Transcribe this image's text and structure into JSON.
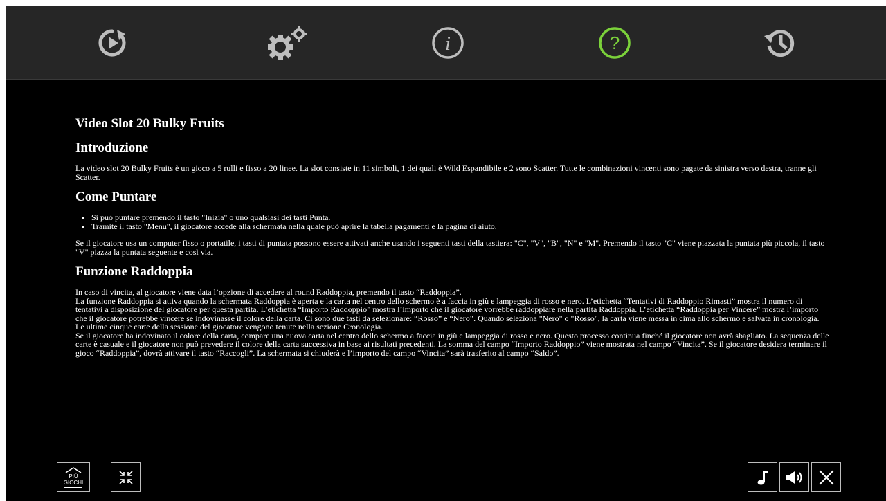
{
  "toolbar": {
    "items": [
      {
        "name": "autoplay-icon"
      },
      {
        "name": "settings-icon"
      },
      {
        "name": "info-icon"
      },
      {
        "name": "help-icon",
        "active": true
      },
      {
        "name": "history-icon"
      }
    ],
    "active_color": "#7bd13a",
    "icon_color": "#bdbdbd"
  },
  "content": {
    "title": "Video Slot 20 Bulky Fruits",
    "intro": {
      "heading": "Introduzione",
      "text": "La video slot 20 Bulky Fruits è un gioco a 5 rulli e fisso a 20 linee. La slot consiste in 11 simboli, 1 dei quali è Wild Espandibile e 2 sono Scatter. Tutte le combinazioni vincenti sono pagate da sinistra verso destra, tranne gli Scatter."
    },
    "betting": {
      "heading": "Come Puntare",
      "bullets": [
        "Si può puntare premendo il tasto \"Inizia\" o uno qualsiasi dei tasti Punta.",
        "Tramite il tasto \"Menu\", il giocatore accede alla schermata nella quale può aprire la tabella pagamenti e la pagina di aiuto."
      ],
      "text": "Se il giocatore usa un computer fisso o portatile, i tasti di puntata possono essere attivati anche usando i seguenti tasti della tastiera: \"C\", \"V\", \"B\", \"N\" e \"M\". Premendo il tasto \"C\" viene piazzata la puntata più piccola, il tasto \"V\" piazza la puntata seguente e così via."
    },
    "gamble": {
      "heading": "Funzione Raddoppia",
      "paragraphs": [
        "In caso di vincita, al giocatore viene data l’opzione di accedere al round Raddoppia, premendo il tasto “Raddoppia”.",
        "La funzione Raddoppia si attiva quando la schermata Raddoppia è aperta e la carta nel centro dello schermo è a faccia in giù e lampeggia di rosso e nero. L’etichetta “Tentativi di Raddoppio Rimasti” mostra il numero di tentativi a disposizione del giocatore per questa partita. L’etichetta “Importo Raddoppio” mostra l’importo che il giocatore vorrebbe raddoppiare nella partita Raddoppia. L’etichetta “Raddoppia per Vincere” mostra l’importo che il giocatore potrebbe vincere se indovinasse il colore della carta. Ci sono due tasti da selezionare: “Rosso” e “Nero”. Quando seleziona \"Nero\" o \"Rosso\", la carta viene messa in cima allo schermo e salvata in cronologia. Le ultime cinque carte della sessione del giocatore vengono tenute nella sezione Cronologia.",
        "Se il giocatore ha indovinato il colore della carta, compare una nuova carta nel centro dello schermo a faccia in giù e lampeggia di rosso e nero. Questo processo continua finché il giocatore non avrà sbagliato. La sequenza delle carte è casuale e il giocatore non può prevedere il colore della carta successiva in base ai risultati precedenti. La somma del campo “Importo Raddoppio” viene mostrata nel campo “Vincita”. Se il giocatore desidera terminare il gioco “Raddoppia”, dovrà attivare il tasto “Raccogli”. La schermata si chiuderà e l’importo del campo “Vincita” sarà trasferito al campo “Saldo”."
      ]
    }
  },
  "bottom": {
    "more_games_line1": "PIÙ",
    "more_games_line2": "GIOCHI",
    "icons": [
      "home-icon",
      "exit-fullscreen-icon",
      "music-icon",
      "sound-icon",
      "close-icon"
    ]
  }
}
